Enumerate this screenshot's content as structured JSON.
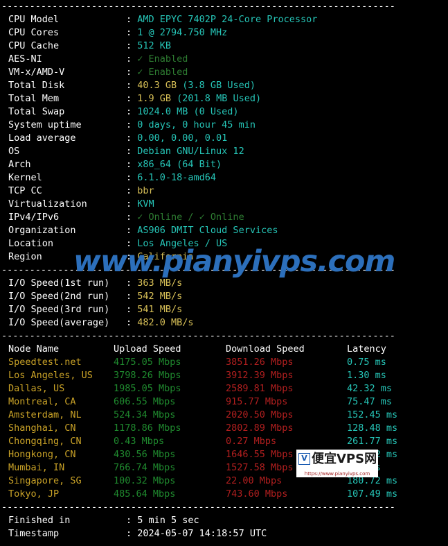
{
  "terminal": {
    "separator": "----------------------------------------------------------------------",
    "sysinfo": [
      {
        "label": "CPU Model",
        "value": "AMD EPYC 7402P 24-Core Processor",
        "color": "cyan"
      },
      {
        "label": "CPU Cores",
        "value": "1 @ 2794.750 MHz",
        "color": "cyan"
      },
      {
        "label": "CPU Cache",
        "value": "512 KB",
        "color": "cyan"
      },
      {
        "label": "AES-NI",
        "value": "✓ Enabled",
        "color": "dkgreen"
      },
      {
        "label": "VM-x/AMD-V",
        "value": "✓ Enabled",
        "color": "dkgreen"
      },
      {
        "label": "Total Disk",
        "value": "40.3 GB (3.8 GB Used)",
        "color": "mixed-yellow-cyan",
        "num": "40.3 GB ",
        "rest": "(3.8 GB Used)"
      },
      {
        "label": "Total Mem",
        "value": "1.9 GB (201.8 MB Used)",
        "color": "mixed-yellow-cyan",
        "num": "1.9 GB ",
        "rest": "(201.8 MB Used)"
      },
      {
        "label": "Total Swap",
        "value": "1024.0 MB (0 Used)",
        "color": "cyan"
      },
      {
        "label": "System uptime",
        "value": "0 days, 0 hour 45 min",
        "color": "cyan"
      },
      {
        "label": "Load average",
        "value": "0.00, 0.00, 0.01",
        "color": "cyan"
      },
      {
        "label": "OS",
        "value": "Debian GNU/Linux 12",
        "color": "cyan"
      },
      {
        "label": "Arch",
        "value": "x86_64 (64 Bit)",
        "color": "cyan"
      },
      {
        "label": "Kernel",
        "value": "6.1.0-18-amd64",
        "color": "cyan"
      },
      {
        "label": "TCP CC",
        "value": "bbr",
        "color": "yellow"
      },
      {
        "label": "Virtualization",
        "value": "KVM",
        "color": "cyan"
      },
      {
        "label": "IPv4/IPv6",
        "value": "✓ Online / ✓ Online",
        "color": "dkgreen"
      },
      {
        "label": "Organization",
        "value": "AS906 DMIT Cloud Services",
        "color": "cyan"
      },
      {
        "label": "Location",
        "value": "Los Angeles / US",
        "color": "cyan"
      },
      {
        "label": "Region",
        "value": "California",
        "color": "yellow"
      }
    ],
    "iospeed": [
      {
        "label": "I/O Speed(1st run)",
        "value": "363 MB/s",
        "color": "yellow"
      },
      {
        "label": "I/O Speed(2nd run)",
        "value": "542 MB/s",
        "color": "yellow"
      },
      {
        "label": "I/O Speed(3rd run)",
        "value": "541 MB/s",
        "color": "yellow"
      },
      {
        "label": "I/O Speed(average)",
        "value": "482.0 MB/s",
        "color": "yellow"
      }
    ],
    "speedtest": {
      "headers": [
        "Node Name",
        "Upload Speed",
        "Download Speed",
        "Latency"
      ],
      "rows": [
        {
          "node": "Speedtest.net",
          "upload": "4175.05 Mbps",
          "download": "3851.26 Mbps",
          "latency": "0.75 ms"
        },
        {
          "node": "Los Angeles, US",
          "upload": "3798.26 Mbps",
          "download": "3912.39 Mbps",
          "latency": "1.30 ms"
        },
        {
          "node": "Dallas, US",
          "upload": "1985.05 Mbps",
          "download": "2589.81 Mbps",
          "latency": "42.32 ms"
        },
        {
          "node": "Montreal, CA",
          "upload": "606.55 Mbps",
          "download": "915.77 Mbps",
          "latency": "75.47 ms"
        },
        {
          "node": "Amsterdam, NL",
          "upload": "524.34 Mbps",
          "download": "2020.50 Mbps",
          "latency": "152.45 ms"
        },
        {
          "node": "Shanghai, CN",
          "upload": "1178.86 Mbps",
          "download": "2802.89 Mbps",
          "latency": "128.48 ms"
        },
        {
          "node": "Chongqing, CN",
          "upload": "0.43 Mbps",
          "download": "0.27 Mbps",
          "latency": "261.77 ms"
        },
        {
          "node": "Hongkong, CN",
          "upload": "430.56 Mbps",
          "download": "1646.55 Mbps",
          "latency": "161.82 ms"
        },
        {
          "node": "Mumbai, IN",
          "upload": "766.74 Mbps",
          "download": "1527.58 Mbps",
          "latency": "223 ms"
        },
        {
          "node": "Singapore, SG",
          "upload": "100.32 Mbps",
          "download": "22.00 Mbps",
          "latency": "180.72 ms"
        },
        {
          "node": "Tokyo, JP",
          "upload": "485.64 Mbps",
          "download": "743.60 Mbps",
          "latency": "107.49 ms"
        }
      ]
    },
    "footer": [
      {
        "label": "Finished in",
        "value": "5 min 5 sec",
        "color": "white"
      },
      {
        "label": "Timestamp",
        "value": "2024-05-07 14:18:57 UTC",
        "color": "white"
      }
    ]
  },
  "watermarks": {
    "big_text": "www.pianyivps.com",
    "big_color": "#2c6fbb",
    "logo_badge": "V",
    "logo_text": "便宜VPS网",
    "logo_url": "https://www.pianyivps.com"
  },
  "colors": {
    "background": "#000000",
    "label": "#ffffff",
    "cyan": "#26c6b8",
    "yellow": "#d8c057",
    "dark_green": "#2e7d32",
    "upload_green": "#1f8a2e",
    "download_red": "#b21f1f",
    "node_gold": "#c9a227"
  }
}
